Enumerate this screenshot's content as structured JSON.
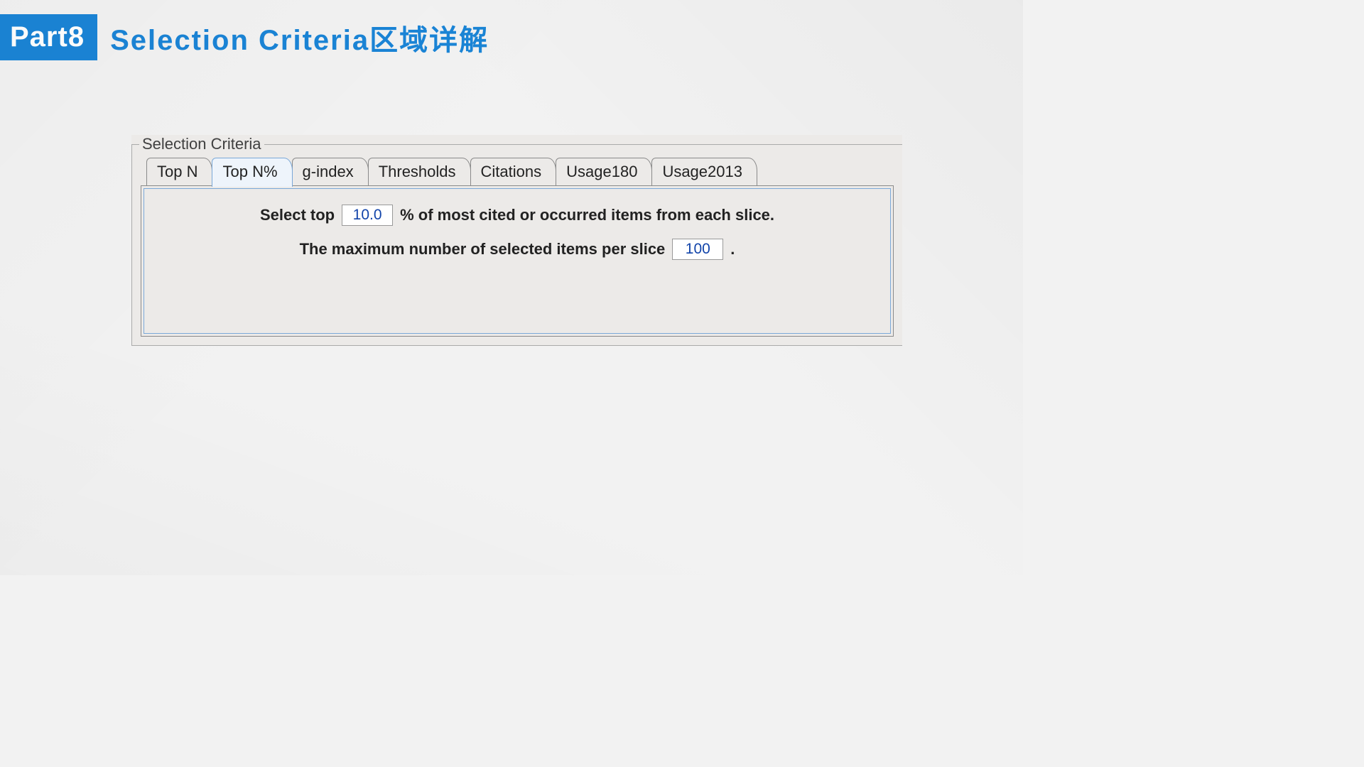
{
  "header": {
    "part_label": "Part8",
    "title": "Selection Criteria区域详解"
  },
  "fieldset": {
    "legend": "Selection Criteria",
    "tabs": [
      {
        "label": "Top N",
        "active": false
      },
      {
        "label": "Top N%",
        "active": true
      },
      {
        "label": "g-index",
        "active": false
      },
      {
        "label": "Thresholds",
        "active": false
      },
      {
        "label": "Citations",
        "active": false
      },
      {
        "label": "Usage180",
        "active": false
      },
      {
        "label": "Usage2013",
        "active": false
      }
    ],
    "panel": {
      "line1_prefix": "Select top",
      "top_percent_value": "10.0",
      "line1_suffix": "% of most cited or occurred items from each slice.",
      "line2_prefix": "The maximum number of selected items per slice",
      "max_items_value": "100",
      "line2_suffix": "."
    }
  }
}
